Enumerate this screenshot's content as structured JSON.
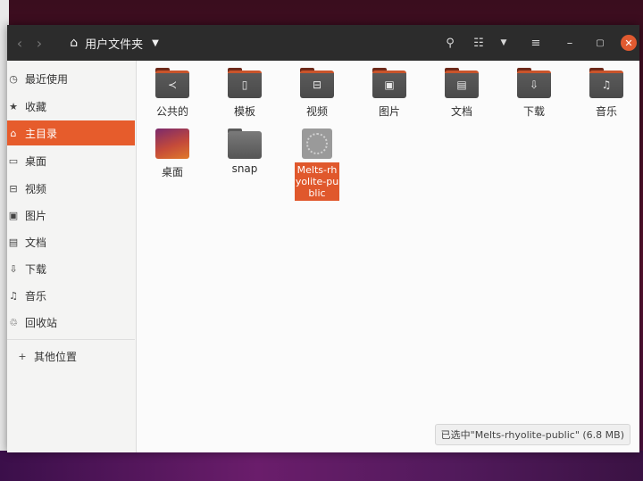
{
  "header": {
    "back_icon": "chevron-left-icon",
    "forward_icon": "chevron-right-icon",
    "path_label": "用户文件夹",
    "search_icon": "search-icon",
    "view_list_icon": "list-view-icon",
    "sort_icon": "chevron-down-icon",
    "menu_icon": "hamburger-menu-icon",
    "minimize_icon": "minimize-icon",
    "maximize_icon": "maximize-icon",
    "close_icon": "close-icon"
  },
  "sidebar": {
    "items": [
      {
        "label": "最近使用",
        "icon": "clock-icon",
        "active": false
      },
      {
        "label": "收藏",
        "icon": "star-icon",
        "active": false
      },
      {
        "label": "主目录",
        "icon": "home-icon",
        "active": true
      },
      {
        "label": "桌面",
        "icon": "desktop-icon",
        "active": false
      },
      {
        "label": "视频",
        "icon": "video-icon",
        "active": false
      },
      {
        "label": "图片",
        "icon": "picture-icon",
        "active": false
      },
      {
        "label": "文档",
        "icon": "document-icon",
        "active": false
      },
      {
        "label": "下载",
        "icon": "download-icon",
        "active": false
      },
      {
        "label": "音乐",
        "icon": "music-icon",
        "active": false
      },
      {
        "label": "回收站",
        "icon": "trash-icon",
        "active": false
      }
    ],
    "other_locations": "其他位置"
  },
  "files": [
    {
      "label": "公共的",
      "icon": "share-icon"
    },
    {
      "label": "模板",
      "icon": "template-icon"
    },
    {
      "label": "视频",
      "icon": "video-icon"
    },
    {
      "label": "图片",
      "icon": "picture-icon"
    },
    {
      "label": "文档",
      "icon": "document-icon"
    },
    {
      "label": "下载",
      "icon": "download-icon"
    },
    {
      "label": "音乐",
      "icon": "music-icon"
    },
    {
      "label": "桌面",
      "icon": "desktop-folder-icon"
    },
    {
      "label": "snap",
      "icon": "folder-icon"
    },
    {
      "label": "Melts-rhyolite-public",
      "icon": "generic-file-icon",
      "selected": true
    }
  ],
  "status": {
    "text": "已选中\"Melts-rhyolite-public\"  (6.8 MB)"
  },
  "colors": {
    "accent": "#e65c2c",
    "headerbar": "#2c2c2c"
  }
}
